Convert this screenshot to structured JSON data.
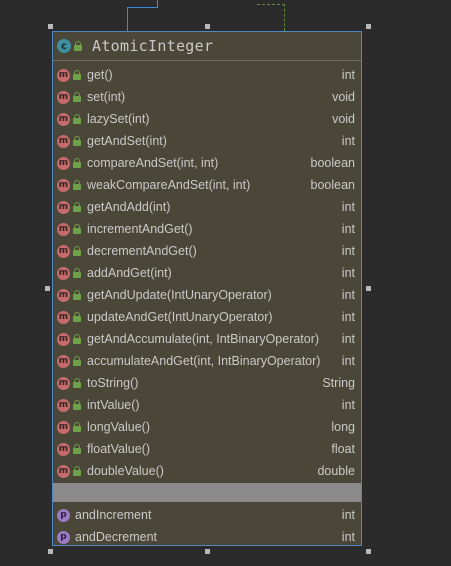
{
  "class": {
    "icon_letter": "c",
    "name": "AtomicInteger"
  },
  "methods": [
    {
      "name": "get()",
      "type": "int"
    },
    {
      "name": "set(int)",
      "type": "void"
    },
    {
      "name": "lazySet(int)",
      "type": "void"
    },
    {
      "name": "getAndSet(int)",
      "type": "int"
    },
    {
      "name": "compareAndSet(int, int)",
      "type": "boolean"
    },
    {
      "name": "weakCompareAndSet(int, int)",
      "type": "boolean"
    },
    {
      "name": "getAndAdd(int)",
      "type": "int"
    },
    {
      "name": "incrementAndGet()",
      "type": "int"
    },
    {
      "name": "decrementAndGet()",
      "type": "int"
    },
    {
      "name": "addAndGet(int)",
      "type": "int"
    },
    {
      "name": "getAndUpdate(IntUnaryOperator)",
      "type": "int"
    },
    {
      "name": "updateAndGet(IntUnaryOperator)",
      "type": "int"
    },
    {
      "name": "getAndAccumulate(int, IntBinaryOperator)",
      "type": "int"
    },
    {
      "name": "accumulateAndGet(int, IntBinaryOperator)",
      "type": "int"
    },
    {
      "name": "toString()",
      "type": "String"
    },
    {
      "name": "intValue()",
      "type": "int"
    },
    {
      "name": "longValue()",
      "type": "long"
    },
    {
      "name": "floatValue()",
      "type": "float"
    },
    {
      "name": "doubleValue()",
      "type": "double"
    }
  ],
  "method_icon_letter": "m",
  "property_icon_letter": "p",
  "properties": [
    {
      "name": "andIncrement",
      "type": "int"
    },
    {
      "name": "andDecrement",
      "type": "int"
    }
  ],
  "colors": {
    "background": "#2b2b2b",
    "box_fill": "#4a4739",
    "box_border": "#4d88c8",
    "method_icon": "#c66b6b",
    "property_icon": "#9b7bc3",
    "class_icon": "#3f8f9f",
    "lock": "#6fa14a",
    "separator": "#8a8a8a",
    "text": "#c9c9c9"
  }
}
